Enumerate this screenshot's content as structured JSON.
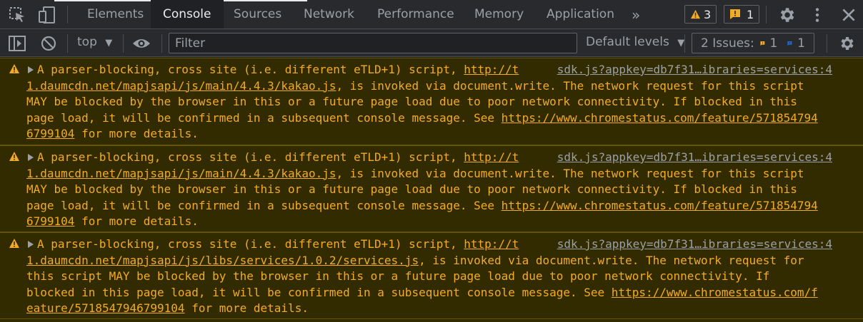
{
  "tabs": [
    {
      "label": "Elements"
    },
    {
      "label": "Console",
      "active": true
    },
    {
      "label": "Sources"
    },
    {
      "label": "Network"
    },
    {
      "label": "Performance"
    },
    {
      "label": "Memory"
    },
    {
      "label": "Application"
    }
  ],
  "more_tabs_glyph": "»",
  "badges": {
    "warnings": "3",
    "issues": "1"
  },
  "toolbar": {
    "context": "top",
    "filter_placeholder": "Filter",
    "levels": "Default levels",
    "issues_label": "2 Issues:",
    "issues_warn_count": "1",
    "issues_info_count": "1"
  },
  "colors": {
    "warning_text": "#f2ab26",
    "warning_bg": "#332b00",
    "accent_blue": "#1a73e8"
  },
  "messages": [
    {
      "source": "sdk.js?appkey=db7f31…ibraries=services:4",
      "line1": "A parser-blocking, cross site (i.e. different eTLD+1) script, ",
      "link1_a": "http://t",
      "link1_b": "1.daumcdn.net/mapjsapi/js/main/4.4.3/kakao.js",
      "after_link1": ", is invoked via document.write. The network request for this script",
      "line3": "MAY be blocked by the browser in this or a future page load due to poor network connectivity. If blocked in this",
      "line4": "page load, it will be confirmed in a subsequent console message. See ",
      "link2_a": "https://www.chromestatus.com/feature/571854794",
      "link2_b": "6799104",
      "tail": " for more details."
    },
    {
      "source": "sdk.js?appkey=db7f31…ibraries=services:4",
      "line1": "A parser-blocking, cross site (i.e. different eTLD+1) script, ",
      "link1_a": "http://t",
      "link1_b": "1.daumcdn.net/mapjsapi/js/main/4.4.3/kakao.js",
      "after_link1": ", is invoked via document.write. The network request for this script",
      "line3": "MAY be blocked by the browser in this or a future page load due to poor network connectivity. If blocked in this",
      "line4": "page load, it will be confirmed in a subsequent console message. See ",
      "link2_a": "https://www.chromestatus.com/feature/571854794",
      "link2_b": "6799104",
      "tail": " for more details."
    },
    {
      "source": "sdk.js?appkey=db7f31…ibraries=services:4",
      "line1": "A parser-blocking, cross site (i.e. different eTLD+1) script, ",
      "link1_a": "http://t",
      "link1_b": "1.daumcdn.net/mapjsapi/js/libs/services/1.0.2/services.js",
      "after_link1": ", is invoked via document.write. The network request for",
      "line3": "this script MAY be blocked by the browser in this or a future page load due to poor network connectivity. If",
      "line4": "blocked in this page load, it will be confirmed in a subsequent console message. See ",
      "link2_a": "https://www.chromestatus.com/f",
      "link2_b": "eature/5718547946799104",
      "tail": " for more details."
    }
  ]
}
